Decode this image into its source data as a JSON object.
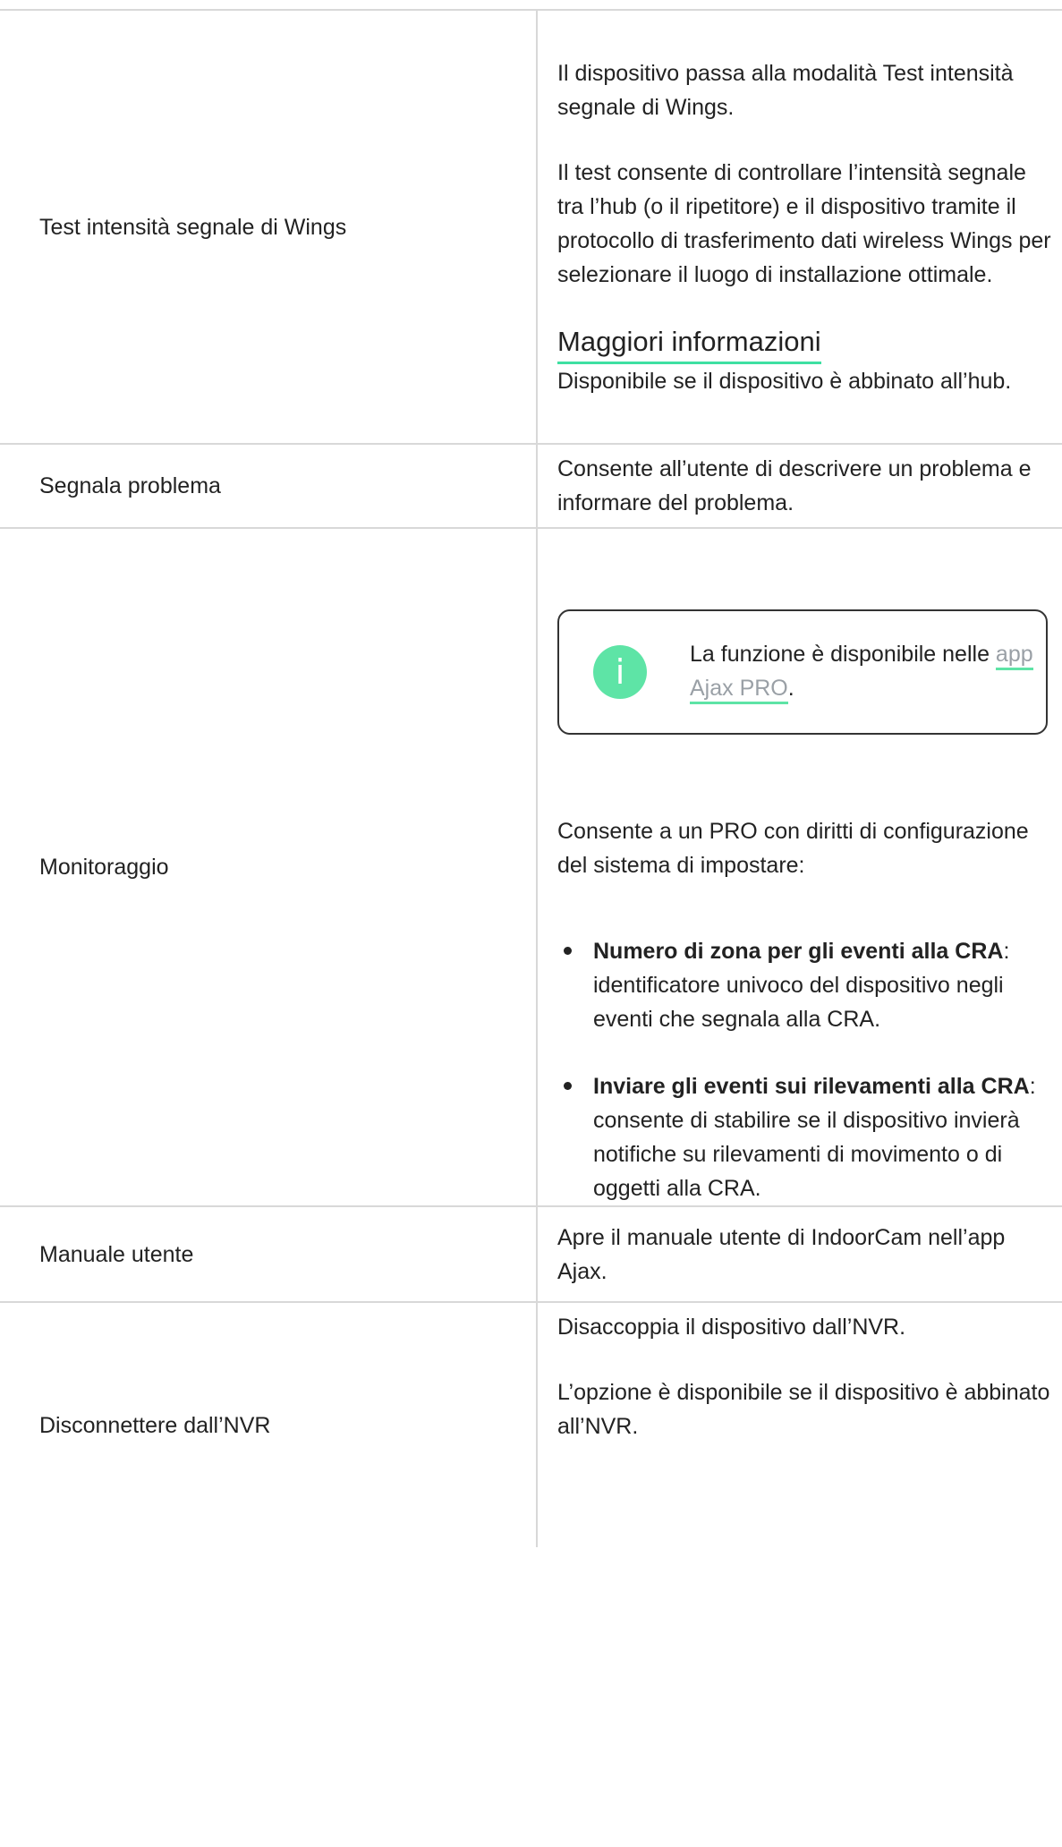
{
  "rows": [
    {
      "name": "Test intensità segnale di Wings",
      "paragraphs": [
        "Il dispositivo passa alla modalità Test intensità segnale di Wings.",
        "Il test consente di controllare l’intensità segnale tra l’hub (o il ripetitore) e il dispositivo tramite il protocollo di trasferimento dati wireless Wings per selezionare il luogo di installazione ottimale."
      ],
      "link": "Maggiori informazioni",
      "note": "Disponibile se il dispositivo è abbinato all’hub."
    },
    {
      "name": "Segnala problema",
      "paragraphs": [
        "Consente all’utente di descrivere un problema e informare del problema."
      ]
    },
    {
      "name": "Monitoraggio",
      "info": {
        "icon": "info-icon",
        "icon_glyph": "i",
        "text_before": "La funzione è disponibile nelle ",
        "link": "app Ajax PRO",
        "text_after": "."
      },
      "intro": "Consente a un PRO con diritti di configurazione del sistema di impostare:",
      "bullets": [
        {
          "bold": "Numero di zona per gli eventi alla CRA",
          "text": ": identificatore univoco del dispositivo negli eventi che segnala alla CRA."
        },
        {
          "bold": "Inviare gli eventi sui rilevamenti alla CRA",
          "text": ": consente di stabilire se il dispositivo invierà notifiche su rilevamenti di movimento o di oggetti alla CRA."
        }
      ]
    },
    {
      "name": "Manuale utente",
      "paragraphs": [
        "Apre il manuale utente di IndoorCam nell’app Ajax."
      ]
    },
    {
      "name": "Disconnettere dall’NVR",
      "paragraphs": [
        "Disaccoppia il dispositivo dall’NVR.",
        "L’opzione è disponibile se il dispositivo è abbinato all’NVR."
      ]
    }
  ],
  "colors": {
    "accent": "#3ee0a2",
    "info_icon_bg": "#5ee4a6",
    "link_text": "#9aa0a6",
    "border": "#d8d8d8"
  }
}
